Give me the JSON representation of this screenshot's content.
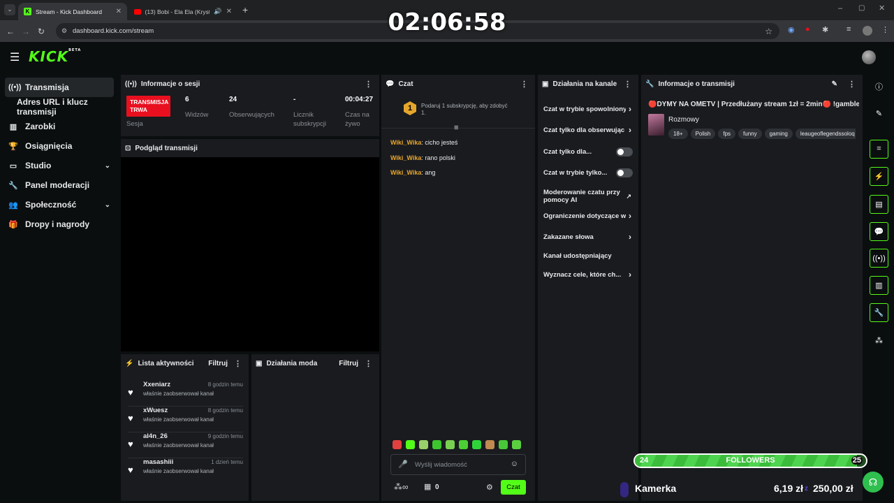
{
  "browser": {
    "tabs": [
      {
        "title": "Stream - Kick Dashboard",
        "active": true
      },
      {
        "title": "(13) Bobi - Ela Ela (Krystek I",
        "active": false
      }
    ],
    "url": "dashboard.kick.com/stream"
  },
  "overlay": {
    "clock": "02:06:58",
    "followers_goal": {
      "label": "FOLLOWERS",
      "current": "24",
      "target": "25",
      "fraction": 0.96
    },
    "kamerka_label": "Kamerka",
    "money_left": "6,19 zł",
    "money_right": "250,00 zł"
  },
  "app": {
    "logo": "KICK",
    "logo_beta": "BETA",
    "accent": "#53fc18"
  },
  "sidebar": {
    "items": [
      {
        "label": "Transmisja",
        "icon": "broadcast-icon"
      },
      {
        "label": "Adres URL i klucz transmisji",
        "icon": ""
      },
      {
        "label": "Zarobki",
        "icon": "earnings-icon"
      },
      {
        "label": "Osiągnięcia",
        "icon": "trophy-icon"
      },
      {
        "label": "Studio",
        "icon": "studio-icon"
      },
      {
        "label": "Panel moderacji",
        "icon": "wrench-icon"
      },
      {
        "label": "Społeczność",
        "icon": "community-icon"
      },
      {
        "label": "Dropy i nagrody",
        "icon": "gift-icon"
      }
    ]
  },
  "session": {
    "title": "Informacje o sesji",
    "live_badge": "TRANSMISJA TRWA",
    "session_label": "Sesja",
    "viewers_value": "6",
    "viewers_label": "Widzów",
    "followers_value": "24",
    "followers_label": "Obserwujących",
    "subs_value": "-",
    "subs_label": "Licznik subskrypcji",
    "uptime_value": "00:04:27",
    "uptime_label": "Czas na żywo"
  },
  "preview": {
    "title": "Podgląd transmisji"
  },
  "activity": {
    "title": "Lista aktywności",
    "filter": "Filtruj",
    "items": [
      {
        "name": "Xxeniarz",
        "time": "8 godzin temu",
        "desc": "właśnie zaobserwował kanał"
      },
      {
        "name": "xWuesz",
        "time": "8 godzin temu",
        "desc": "właśnie zaobserwował kanał"
      },
      {
        "name": "al4n_26",
        "time": "9 godzin temu",
        "desc": "właśnie zaobserwował kanał"
      },
      {
        "name": "masashiii",
        "time": "1 dzień temu",
        "desc": "właśnie zaobserwował kanał"
      }
    ]
  },
  "mod_actions": {
    "title": "Działania moda",
    "filter": "Filtruj"
  },
  "chat": {
    "title": "Czat",
    "gift_badge": "1",
    "gift_text": "Podaruj 1 subskrypcję, aby zdobyć 1.",
    "messages": [
      {
        "user": "Wiki_Wika",
        "text": ": cicho jesteś"
      },
      {
        "user": "Wiki_Wika",
        "text": ": rano polski"
      },
      {
        "user": "Wiki_Wika",
        "text": ": ang"
      }
    ],
    "input_placeholder": "Wyślij wiadomość",
    "points": "0",
    "send_label": "Czat"
  },
  "channel_actions": {
    "title": "Działania na kanale",
    "items": [
      {
        "label": "Czat w trybie spowolniony",
        "control": "arrow"
      },
      {
        "label": "Czat tylko dla obserwując",
        "control": "arrow"
      },
      {
        "label": "Czat tylko dla...",
        "control": "toggle"
      },
      {
        "label": "Czat w trybie tylko...",
        "control": "toggle"
      },
      {
        "label": "Moderowanie czatu przy pomocy AI",
        "control": "external"
      },
      {
        "label": "Ograniczenie dotyczące w",
        "control": "arrow"
      },
      {
        "label": "Zakazane słowa",
        "control": "arrow"
      },
      {
        "label": "Kanał udostępniający",
        "control": "none"
      },
      {
        "label": "Wyznacz cele, które ch...",
        "control": "arrow"
      }
    ]
  },
  "stream_info": {
    "title": "Informacje o transmisji",
    "stream_title": "🔴DYMY NA OMETV | Przedłużany stream 1zł = 2min🔴 !gamble",
    "category": "Rozmowy",
    "tags": [
      "18+",
      "Polish",
      "fps",
      "funny",
      "gaming",
      "leaugeoflegendssoloq"
    ]
  }
}
